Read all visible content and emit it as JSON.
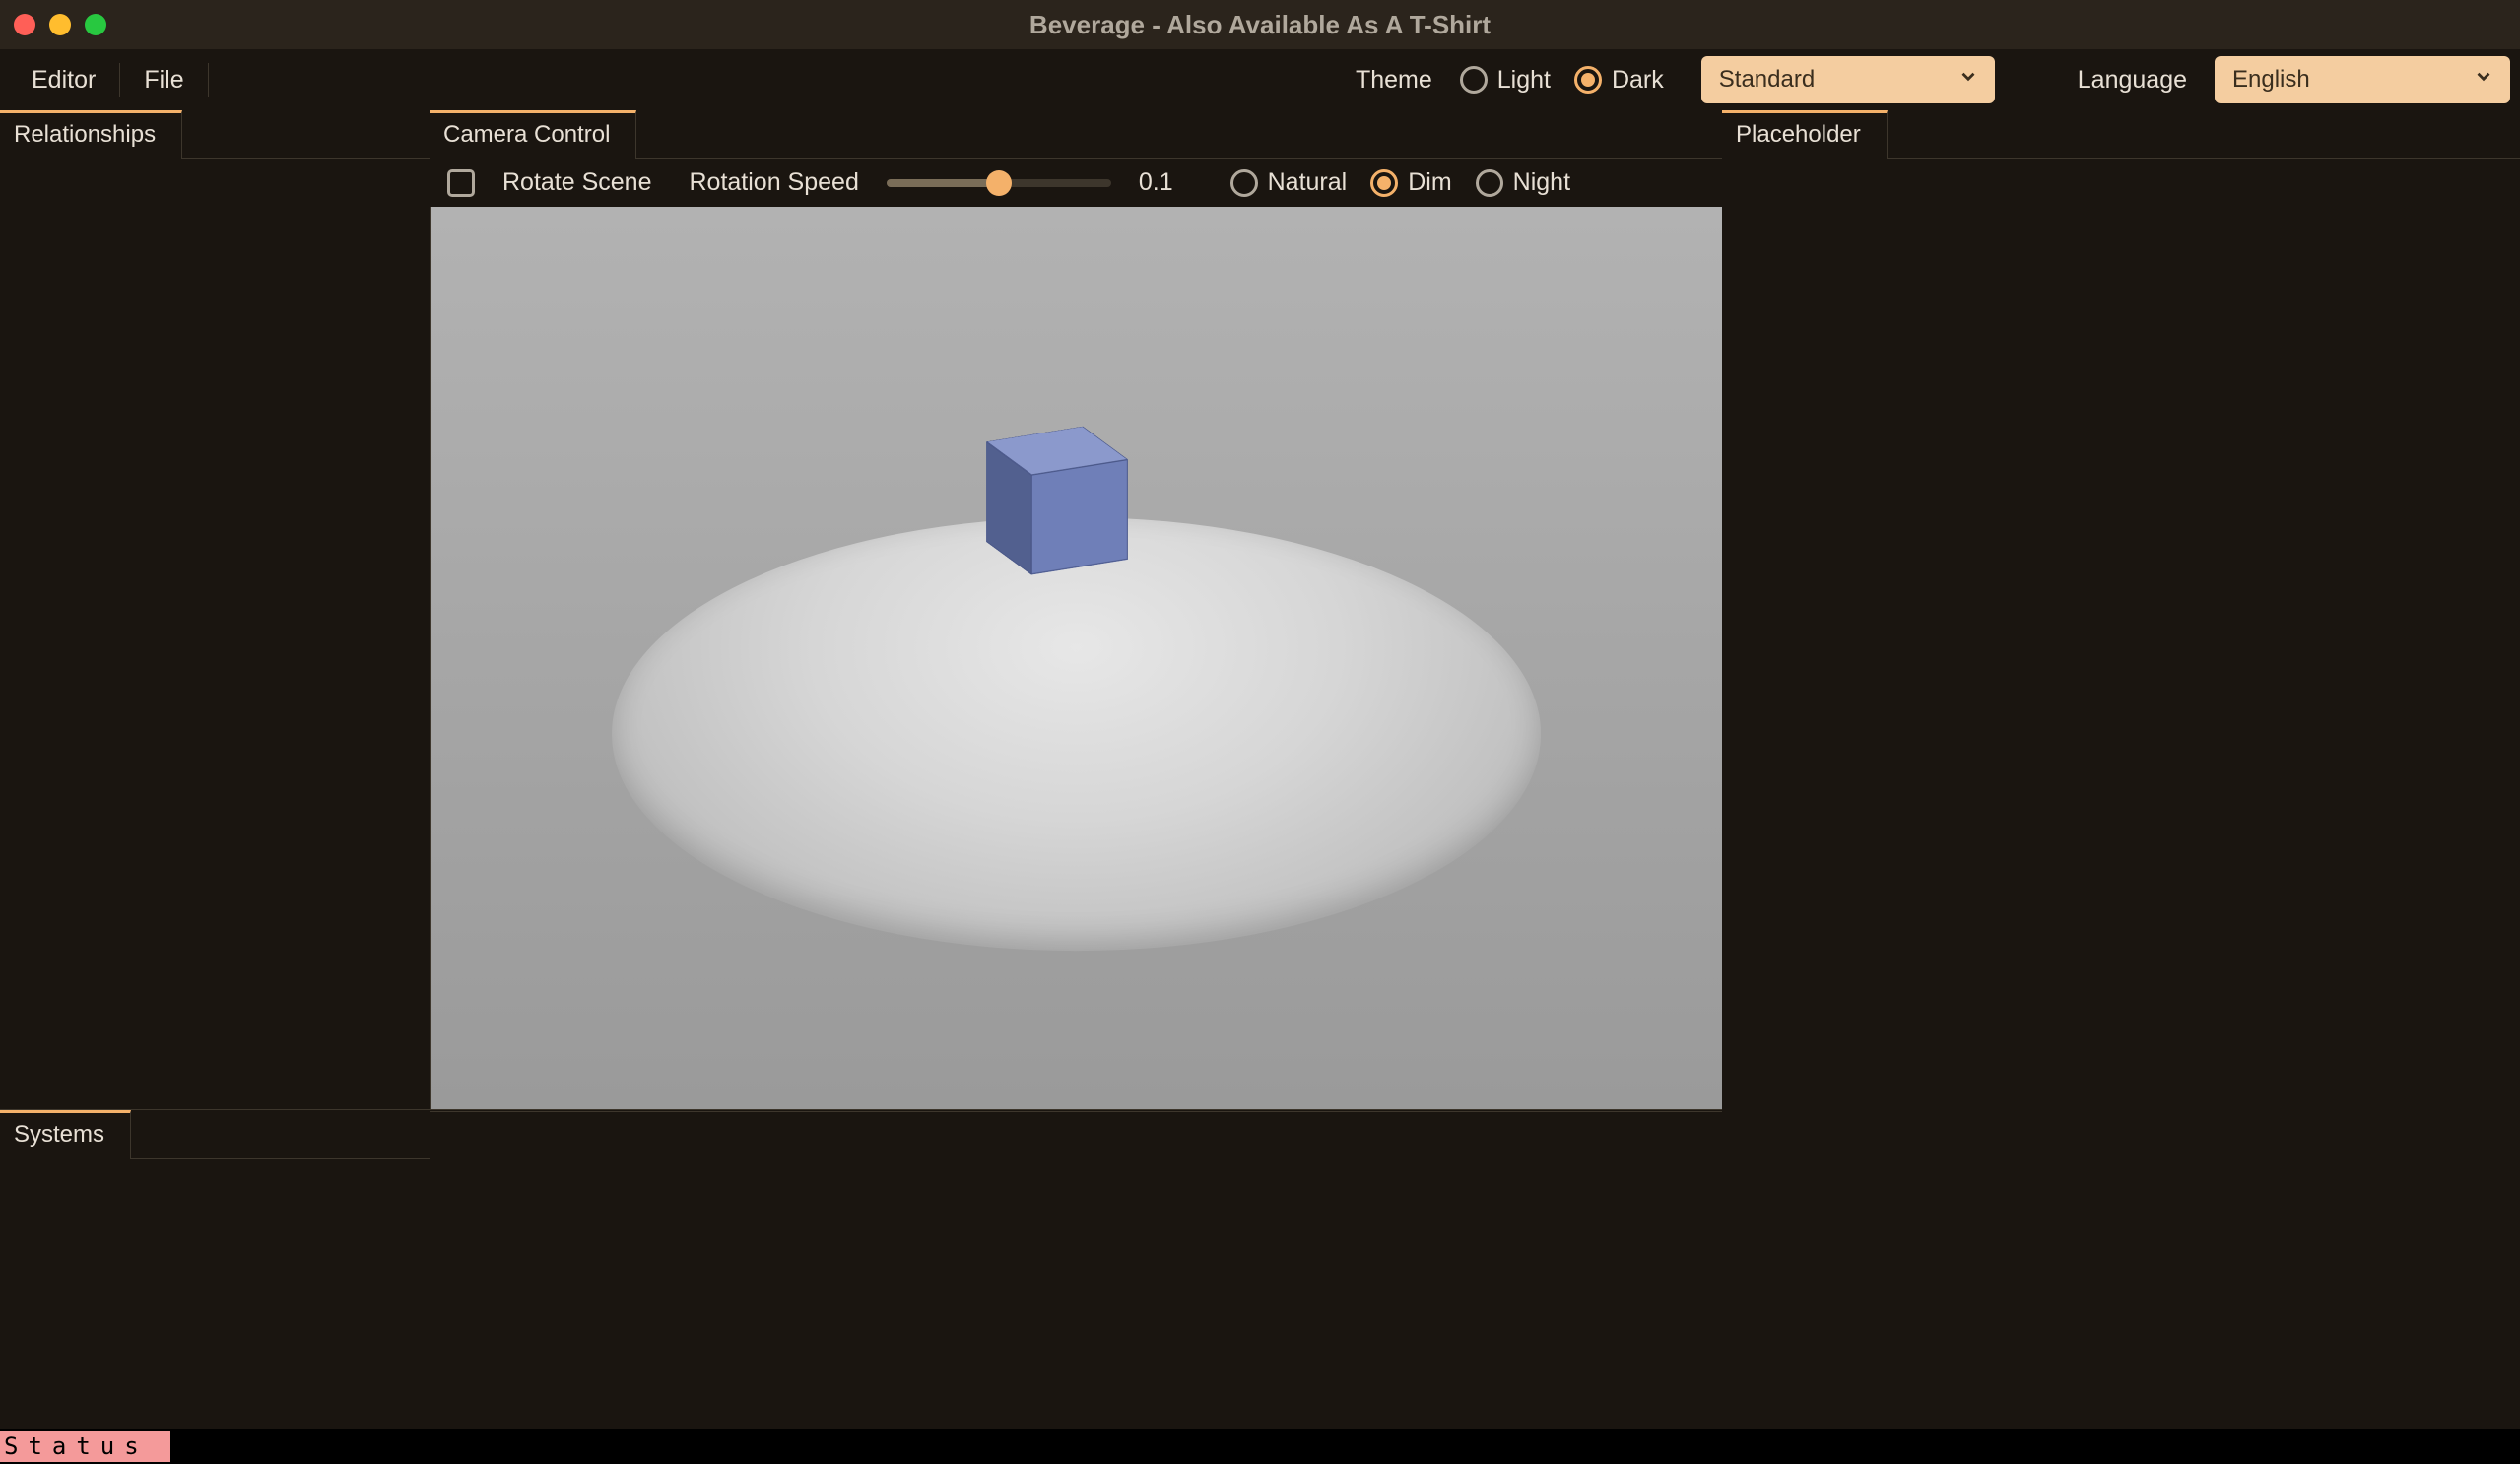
{
  "window": {
    "title": "Beverage - Also Available As A T-Shirt"
  },
  "menus": {
    "editor": "Editor",
    "file": "File"
  },
  "theme": {
    "label": "Theme",
    "options": {
      "light": "Light",
      "dark": "Dark"
    },
    "selected": "dark",
    "variant_selected": "Standard"
  },
  "language": {
    "label": "Language",
    "selected": "English"
  },
  "colors": {
    "accent": "#f4b16a",
    "select_bg": "#f4cda0",
    "status_pill": "#f49a9a"
  },
  "left_panel": {
    "tabs": [
      "Relationships"
    ]
  },
  "center_panel": {
    "tabs": [
      "Camera Control"
    ],
    "controls": {
      "rotate_scene_label": "Rotate Scene",
      "rotate_scene_checked": false,
      "rotation_speed_label": "Rotation Speed",
      "rotation_speed_value": "0.1",
      "rotation_speed_pct": 50,
      "lighting": {
        "options": {
          "natural": "Natural",
          "dim": "Dim",
          "night": "Night"
        },
        "selected": "dim"
      }
    },
    "bottom_tabs": [
      "Systems"
    ]
  },
  "right_panel": {
    "tabs": [
      "Placeholder"
    ]
  },
  "status": {
    "text": "Status"
  }
}
